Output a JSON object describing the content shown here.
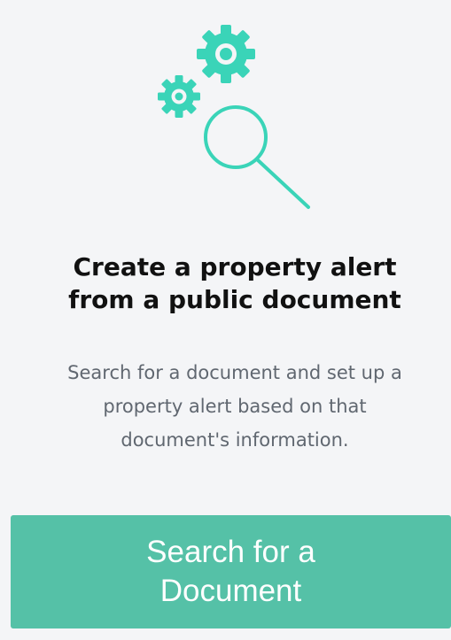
{
  "card": {
    "title_line1": "Create a property alert",
    "title_line2": "from a public document",
    "desc_line1": "Search for a document and set up a",
    "desc_line2": "property alert based on that",
    "desc_line3": "document's information.",
    "button_line1": "Search for a",
    "button_line2": "Document"
  },
  "colors": {
    "accent": "#3ad4b8",
    "button": "#55c1a7",
    "title": "#111111",
    "description": "#606770",
    "background": "#f4f5f7"
  },
  "icons": [
    "gear-icon",
    "gear-icon",
    "magnifier-icon"
  ]
}
